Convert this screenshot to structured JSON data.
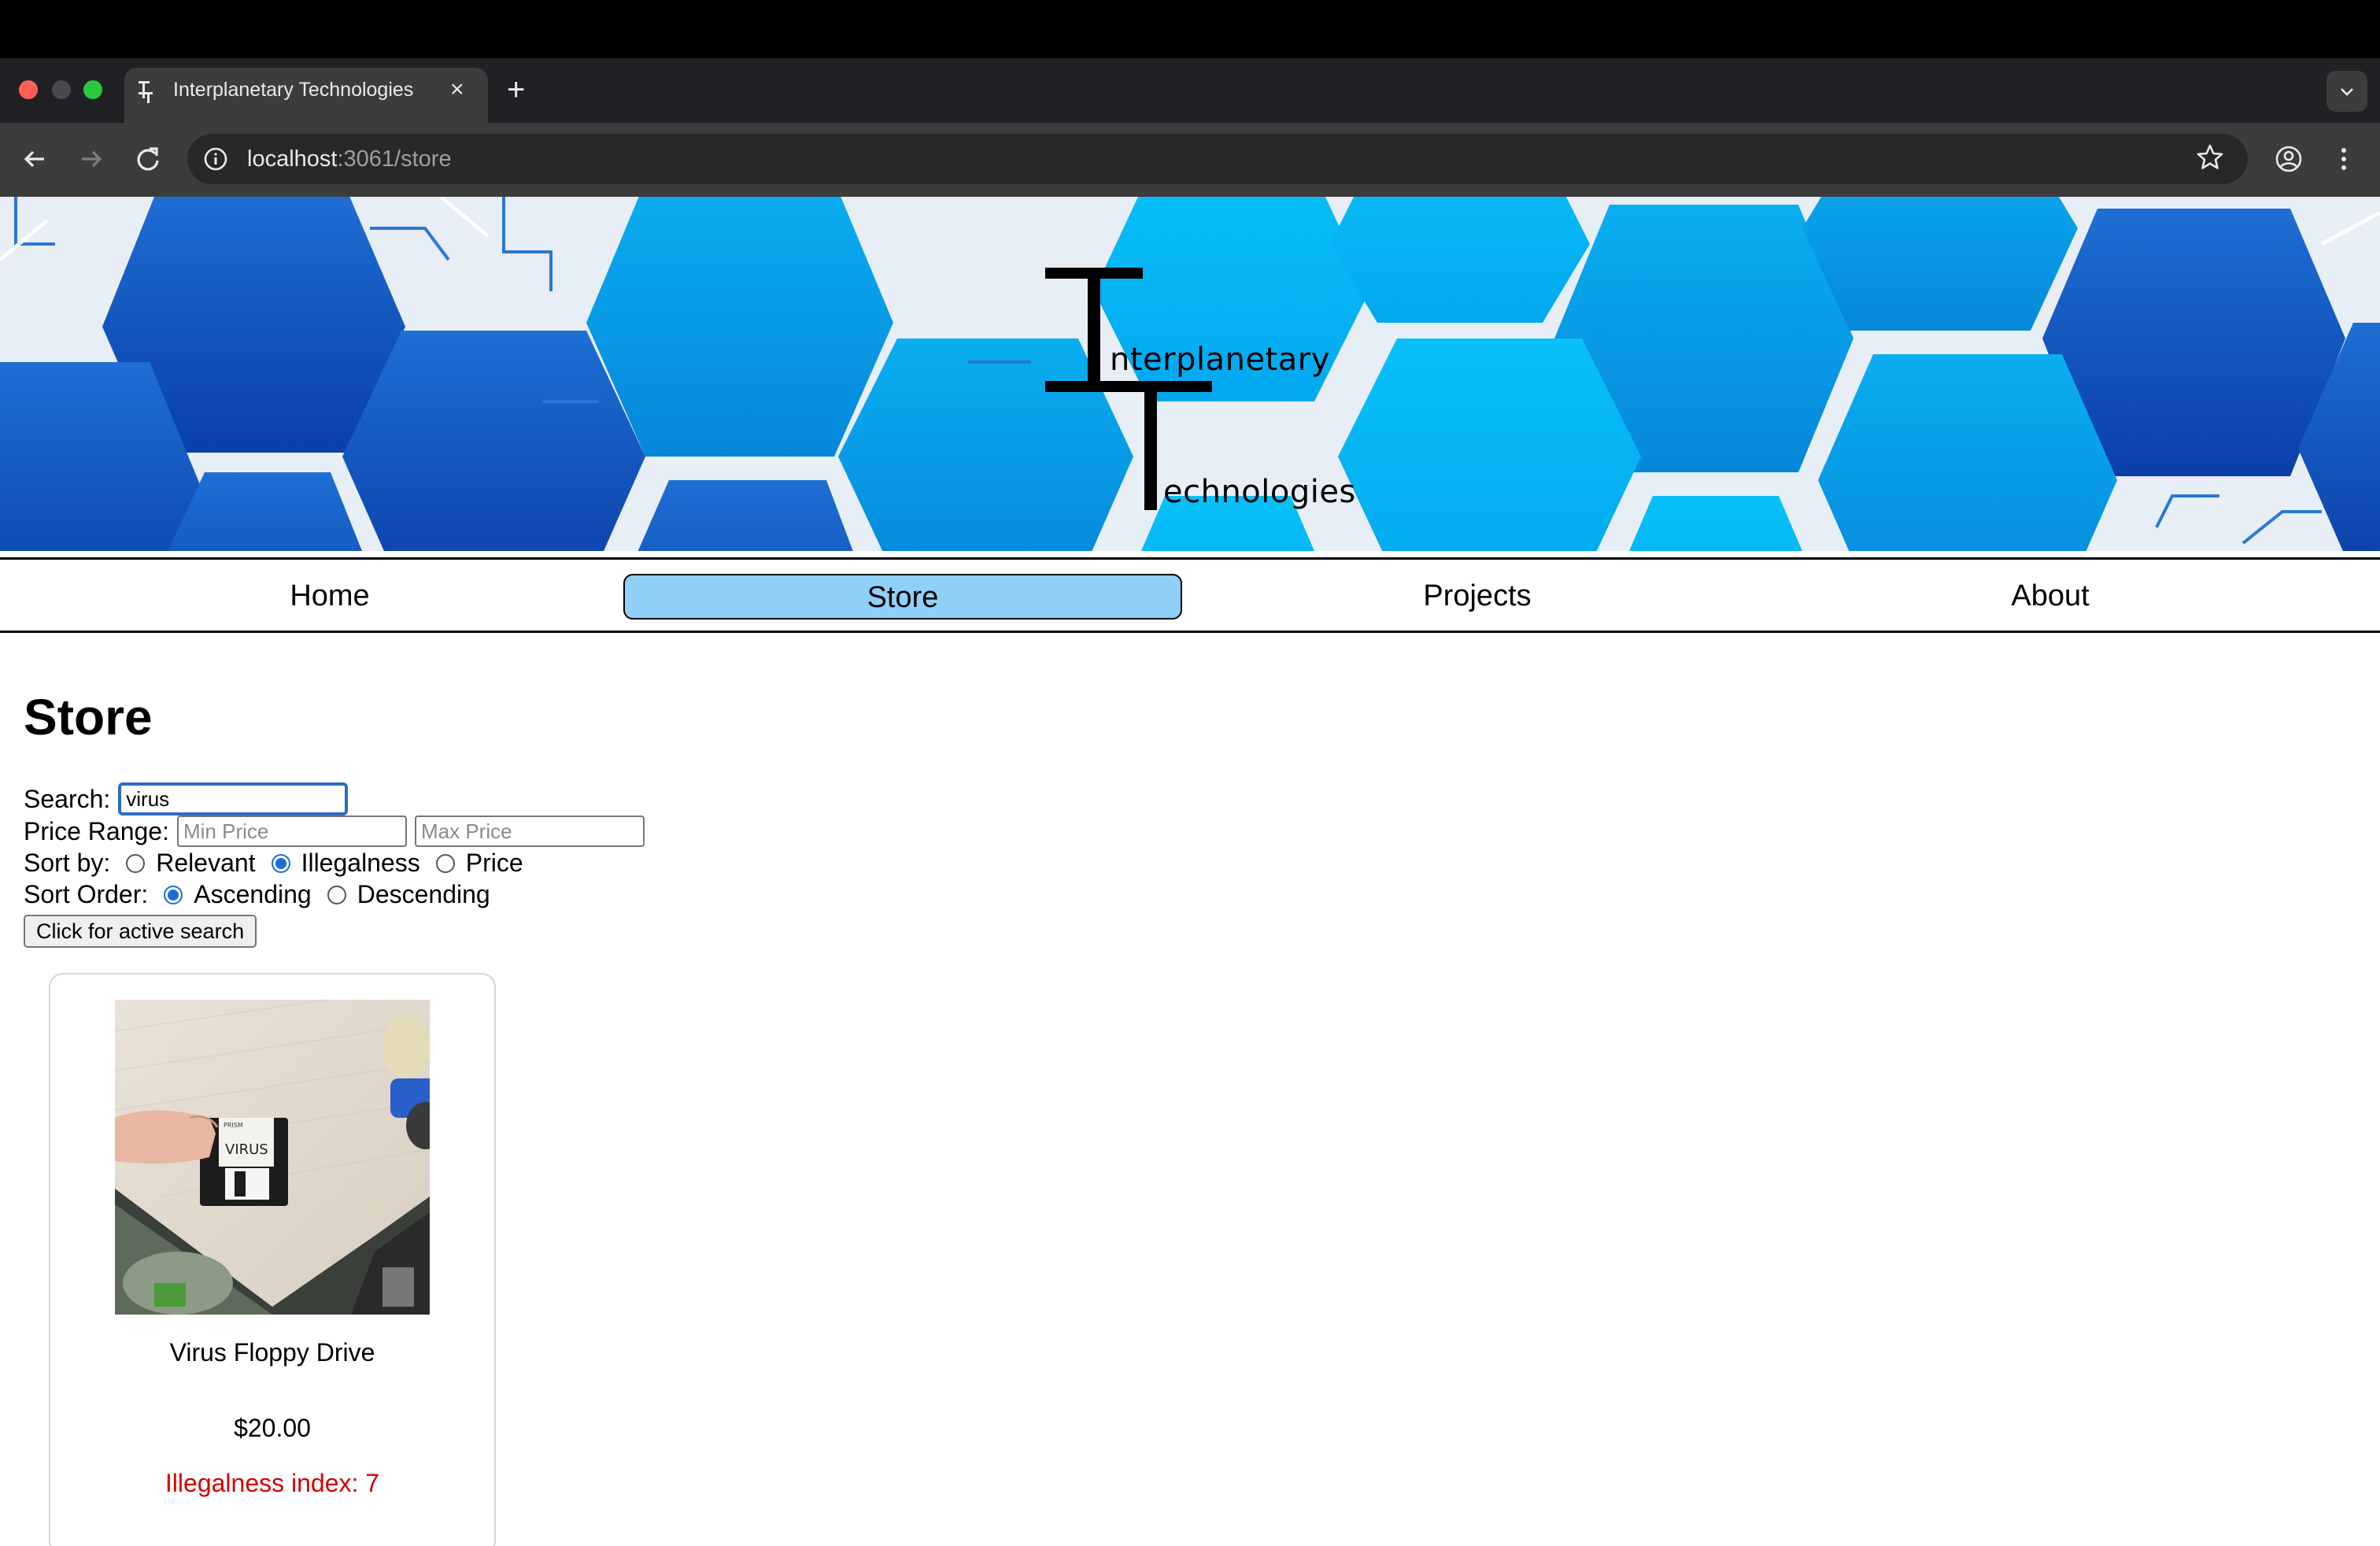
{
  "browser": {
    "tab_title": "Interplanetary Technologies",
    "tab_close": "×",
    "new_tab": "+",
    "url_host": "localhost",
    "url_rest": ":3061/store"
  },
  "banner": {
    "logo_word1": "nterplanetary",
    "logo_word2": "echnologies",
    "logo_initials": "IT"
  },
  "nav": {
    "items": [
      {
        "label": "Home"
      },
      {
        "label": "Store",
        "active": true
      },
      {
        "label": "Projects"
      },
      {
        "label": "About"
      }
    ]
  },
  "store": {
    "title": "Store",
    "search_label": "Search:",
    "search_value": "virus",
    "price_label": "Price Range:",
    "min_placeholder": "Min Price",
    "max_placeholder": "Max Price",
    "sort_label": "Sort by:",
    "sort_options": [
      "Relevant",
      "Illegalness",
      "Price"
    ],
    "sort_selected": "Illegalness",
    "order_label": "Sort Order:",
    "order_options": [
      "Ascending",
      "Descending"
    ],
    "order_selected": "Ascending",
    "active_button": "Click for active search"
  },
  "products": [
    {
      "name": "Virus Floppy Drive",
      "price": "$20.00",
      "illegalness": "Illegalness index: 7",
      "disk_label": "VIRUS",
      "disk_brand": "PRISM"
    }
  ],
  "colors": {
    "nav_active": "#90d0f8",
    "illegal_text": "#d40000",
    "hex_blue": "#0a9be8"
  }
}
